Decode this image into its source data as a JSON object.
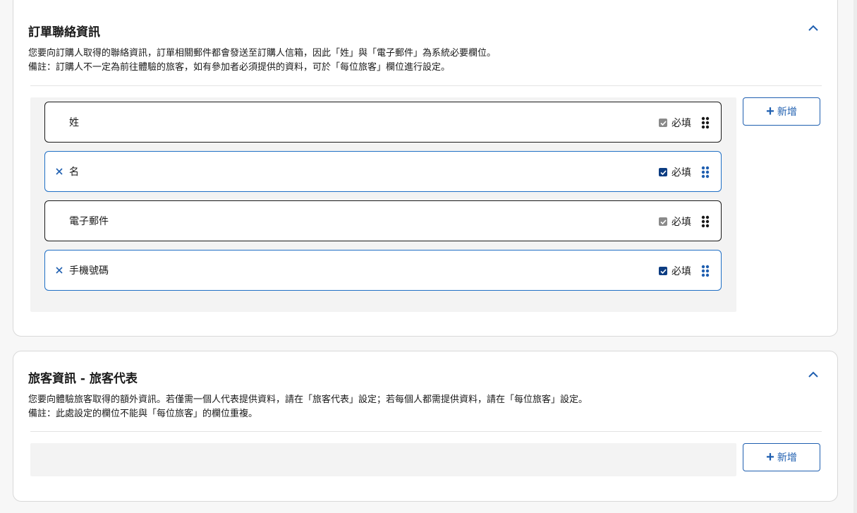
{
  "contact_section": {
    "title": "訂單聯絡資訊",
    "desc_line1": "您要向訂購人取得的聯絡資訊，訂單相關郵件都會發送至訂購人信箱，因此「姓」與「電子郵件」為系統必要欄位。",
    "desc_line2": "備註：訂購人不一定為前往體驗的旅客，如有參加者必須提供的資料，可於「每位旅客」欄位進行設定。",
    "add_label": "新增",
    "fields": [
      {
        "label": "姓",
        "required_label": "必填",
        "locked": true
      },
      {
        "label": "名",
        "required_label": "必填",
        "locked": false
      },
      {
        "label": "電子郵件",
        "required_label": "必填",
        "locked": true
      },
      {
        "label": "手機號碼",
        "required_label": "必填",
        "locked": false
      }
    ]
  },
  "traveler_section": {
    "title": "旅客資訊 - 旅客代表",
    "desc_line1": "您要向體驗旅客取得的額外資訊。若僅需一個人代表提供資料，請在「旅客代表」設定；若每個人都需提供資料，請在「每位旅客」設定。",
    "desc_line2": "備註：此處設定的欄位不能與「每位旅客」的欄位重複。",
    "add_label": "新增"
  },
  "icons": {
    "collapse": "chevron-up-icon",
    "remove": "close-icon",
    "drag": "drag-handle-icon",
    "add": "plus-icon"
  },
  "colors": {
    "accent": "#1f5fb0",
    "checkbox_checked": "#0d3d82",
    "checkbox_disabled": "#8a8a8a"
  }
}
